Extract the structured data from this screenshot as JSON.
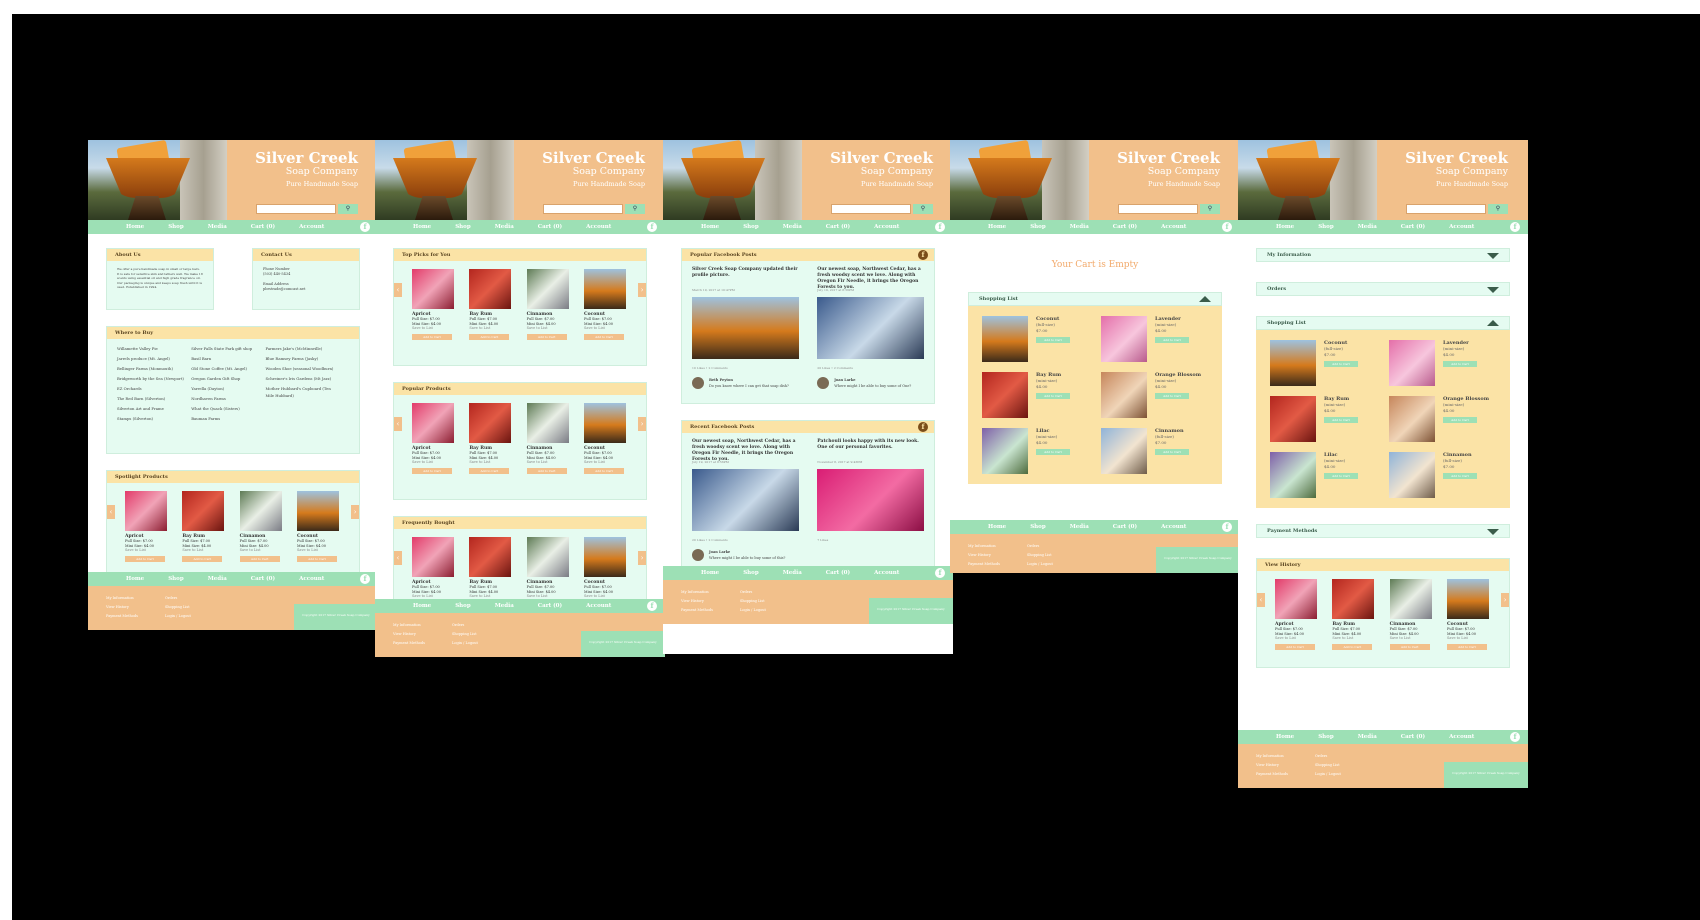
{
  "brand": {
    "title": "Silver Creek",
    "subtitle": "Soap Company",
    "tagline": "Pure Handmade Soap"
  },
  "nav": [
    "Home",
    "Shop",
    "Media",
    "Cart (0)",
    "Account"
  ],
  "colors": {
    "peach": "#f2c08b",
    "mint": "#9de0b5",
    "mint_light": "#e5fbf1",
    "cream": "#fbe3a6",
    "black": "#000000"
  },
  "icons": {
    "search": "magnifier",
    "facebook": "f-circle",
    "arrow_left": "‹",
    "arrow_right": "›",
    "expand": "▼",
    "collapse": "▲"
  },
  "footer": {
    "col1": [
      "My Information",
      "View History",
      "Payment Methods"
    ],
    "col2": [
      "Orders",
      "Shopping List",
      "Login / Logout"
    ],
    "copyright": "Copyright 2017 Silver Creek Soap Company"
  },
  "products": [
    {
      "name": "Apricot",
      "full": "Full Size: $7.00",
      "mini": "Mini Size: $4.00",
      "save": "Save to List",
      "btn": "Add to Cart"
    },
    {
      "name": "Bay Rum",
      "full": "Full Size: $7.00",
      "mini": "Mini Size: $4.00",
      "save": "Save to List",
      "btn": "Add to Cart"
    },
    {
      "name": "Cinnamon",
      "full": "Full Size: $7.00",
      "mini": "Mini Size: $4.00",
      "save": "Save to List",
      "btn": "Add to Cart"
    },
    {
      "name": "Coconut",
      "full": "Full Size: $7.00",
      "mini": "Mini Size: $4.00",
      "save": "Save to List",
      "btn": "Add to Cart"
    }
  ],
  "home": {
    "about_title": "About Us",
    "about_text": "We offer a pure handmade soap in small or large bars. It is safe for sensitive skin and lathers well. We make 18 scents using essential oil and high grade fragrance oil. Our packaging is unique and keeps soap fresh until it is used. Established in 1994.",
    "contact_title": "Contact Us",
    "contact_lines": [
      "Phone Number",
      "(503) 440-5434",
      "",
      "Email Address",
      "pbrstrade@comcast.net"
    ],
    "where_title": "Where to Buy",
    "where_cols": [
      [
        "Willamette Valley Pie",
        "Jarrels produce (Mt. Angel)",
        "Bellinger Farms (Monmouth)",
        "Bridgeworth by the Sea (Newport)",
        "EZ Orchards",
        "The Red Barn (Silverton)",
        "Silverton Art and Frame",
        "Stamps (Silverton)"
      ],
      [
        "Silver Falls State Park gift shop",
        "Basil Barn",
        "Old Stone Coffee (Mt. Angel)",
        "Oregon Garden Gift Shop",
        "Yarrella (Dayton)",
        "Nordhaven Farms",
        "What the Quack (Sisters)",
        "Bauman Farms"
      ],
      [
        "Farmers Jake's (McMinnville)",
        "Blue Ramsey Farms (Jasky)",
        "Wooden Shoe (seasonal Woodburn)",
        "Schreiner's Iris Gardens (Mt Jazz)",
        "Mother Hubbard's Cupboard (Ten Mile Hubbard)"
      ]
    ],
    "spotlight_title": "Spotlight Products"
  },
  "shop": {
    "sections": [
      "Top Picks for You",
      "Popular Products",
      "Frequently Bought"
    ]
  },
  "media": {
    "popular_title": "Popular Facebook Posts",
    "recent_title": "Recent Facebook Posts",
    "popular_posts": [
      {
        "text": "Silver Creek Soap Company updated their profile picture.",
        "date": "March 19, 2017 at 10:47PM",
        "likes": "10 Likes • 2 Comments",
        "commenter": "Beth Peyton",
        "comment": "Do you know where I can get that soap dish?"
      },
      {
        "text": "Our newest soap, Northwest Cedar, has a fresh woodsy scent we love. Along with Oregon Fir Needle, it brings the Oregon Forests to you.",
        "date": "July 19, 2017 at 8:56PM",
        "likes": "20 Likes • 2 Comments",
        "commenter": "Joan Larke",
        "comment": "Where might I be able to buy some of One?"
      }
    ],
    "recent_posts": [
      {
        "text": "Our newest soap, Northwest Cedar, has a fresh woodsy scent we love. Along with Oregon Fir Needle, it brings the Oregon Forests to you.",
        "date": "July 19, 2017 at 8:56PM",
        "likes": "20 Likes • 2 Comments",
        "commenter": "Joan Larke",
        "comment": "Where might I be able to buy some of this?"
      },
      {
        "text": "Patchouli looks happy with its new look. One of our personal favorites.",
        "date": "November 8, 2017 at 9:43PM",
        "likes": "7 Likes",
        "commenter": "",
        "comment": ""
      }
    ]
  },
  "cart": {
    "empty": "Your Cart is Empty",
    "list_title": "Shopping List",
    "items": [
      {
        "name": "Coconut",
        "size": "(full-size)",
        "price": "$7.00",
        "btn": "Add to Cart"
      },
      {
        "name": "Lavender",
        "size": "(mini-size)",
        "price": "$4.00",
        "btn": "Add to Cart"
      },
      {
        "name": "Bay Rum",
        "size": "(mini-size)",
        "price": "$4.00",
        "btn": "Add to Cart"
      },
      {
        "name": "Orange Blossom",
        "size": "(mini-size)",
        "price": "$4.00",
        "btn": "Add to Cart"
      },
      {
        "name": "Lilac",
        "size": "(mini-size)",
        "price": "$4.00",
        "btn": "Add to Cart"
      },
      {
        "name": "Cinnamon",
        "size": "(full-size)",
        "price": "$7.00",
        "btn": "Add to Cart"
      }
    ]
  },
  "account": {
    "sections": [
      "My Information",
      "Orders",
      "Shopping List",
      "Payment Methods"
    ],
    "history_title": "View History"
  }
}
